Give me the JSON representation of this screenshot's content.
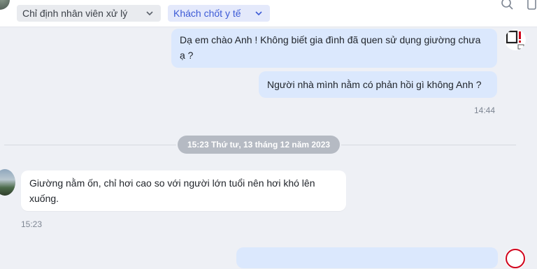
{
  "toolbar": {
    "assign_dropdown": "Chỉ định nhân viên xử lý",
    "tag_dropdown": "Khách chốt y tế"
  },
  "messages": [
    {
      "direction": "outgoing",
      "text": "Dạ em chào Anh ! Không biết gia đình đã quen sử dụng giường chưa ạ ?"
    },
    {
      "direction": "outgoing",
      "text": "Người nhà mình nằm có phản hồi gì không Anh ?"
    },
    {
      "direction": "incoming",
      "text": "Giường nằm ốn, chỉ hơi cao so với người lớn tuổi nên hơi khó lên xuống."
    }
  ],
  "times": {
    "outgoing_group": "14:44",
    "incoming_group": "15:23"
  },
  "date_separator": "15:23 Thứ tư, 13 tháng 12 năm 2023",
  "colors": {
    "background": "#eef0f5",
    "outgoing_bubble": "#dbe8fd",
    "incoming_bubble": "#ffffff",
    "tag_accent": "#3d5bd6"
  }
}
